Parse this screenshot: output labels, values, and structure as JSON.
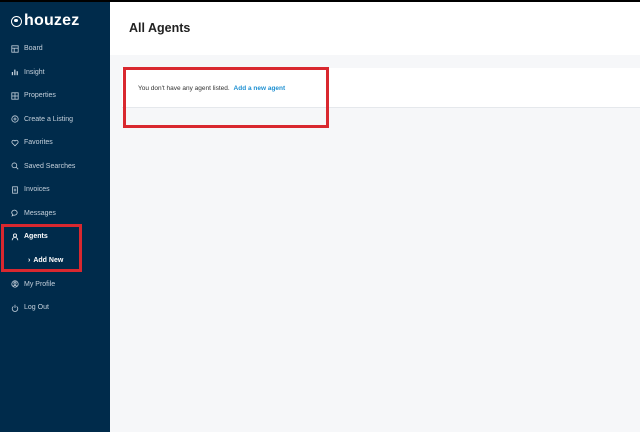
{
  "app": {
    "logo_text": "houzez"
  },
  "sidebar": {
    "items": [
      {
        "label": "Board",
        "icon": "board-icon"
      },
      {
        "label": "Insight",
        "icon": "chart-icon"
      },
      {
        "label": "Properties",
        "icon": "properties-icon"
      },
      {
        "label": "Create a Listing",
        "icon": "plus-circle-icon"
      },
      {
        "label": "Favorites",
        "icon": "heart-icon"
      },
      {
        "label": "Saved Searches",
        "icon": "search-icon"
      },
      {
        "label": "Invoices",
        "icon": "invoice-icon"
      },
      {
        "label": "Messages",
        "icon": "chat-icon"
      },
      {
        "label": "Agents",
        "icon": "user-icon",
        "active": true
      },
      {
        "label": "My Profile",
        "icon": "profile-icon"
      },
      {
        "label": "Log Out",
        "icon": "power-icon"
      }
    ],
    "sub_item": {
      "label": "Add New",
      "parent": "Agents"
    }
  },
  "main": {
    "title": "All Agents",
    "empty_message": "You don't have any agent listed.",
    "empty_link": "Add a new agent"
  },
  "colors": {
    "sidebar_bg": "#002b4b",
    "link": "#1e90d2",
    "highlight": "#d9282f"
  }
}
